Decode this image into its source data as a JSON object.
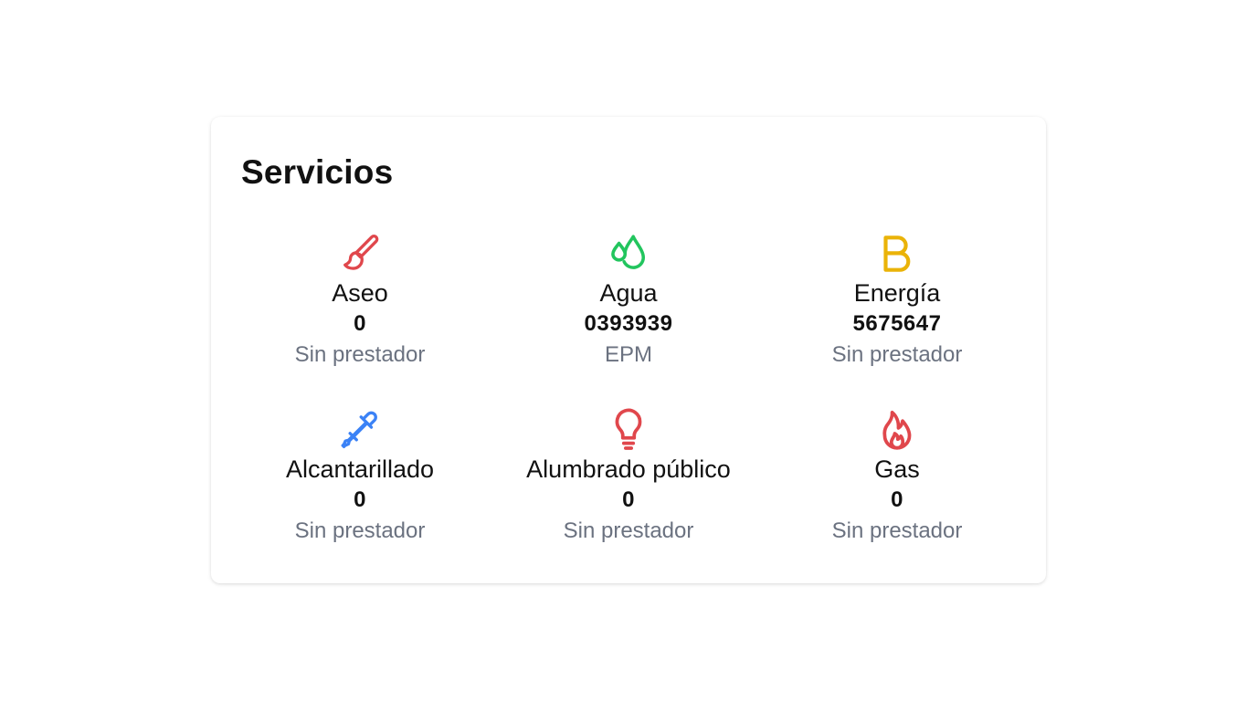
{
  "card": {
    "title": "Servicios"
  },
  "services": [
    {
      "name": "Aseo",
      "number": "0",
      "provider": "Sin prestador",
      "icon": "paint-brush-icon",
      "color": "#e0474c"
    },
    {
      "name": "Agua",
      "number": "0393939",
      "provider": "EPM",
      "icon": "water-drops-icon",
      "color": "#22c55e"
    },
    {
      "name": "Energía",
      "number": "5675647",
      "provider": "Sin prestador",
      "icon": "letter-b-icon",
      "color": "#eab308"
    },
    {
      "name": "Alcantarillado",
      "number": "0",
      "provider": "Sin prestador",
      "icon": "pipette-icon",
      "color": "#3b82f6"
    },
    {
      "name": "Alumbrado público",
      "number": "0",
      "provider": "Sin prestador",
      "icon": "light-bulb-icon",
      "color": "#e0474c"
    },
    {
      "name": "Gas",
      "number": "0",
      "provider": "Sin prestador",
      "icon": "flame-icon",
      "color": "#e0474c"
    }
  ]
}
